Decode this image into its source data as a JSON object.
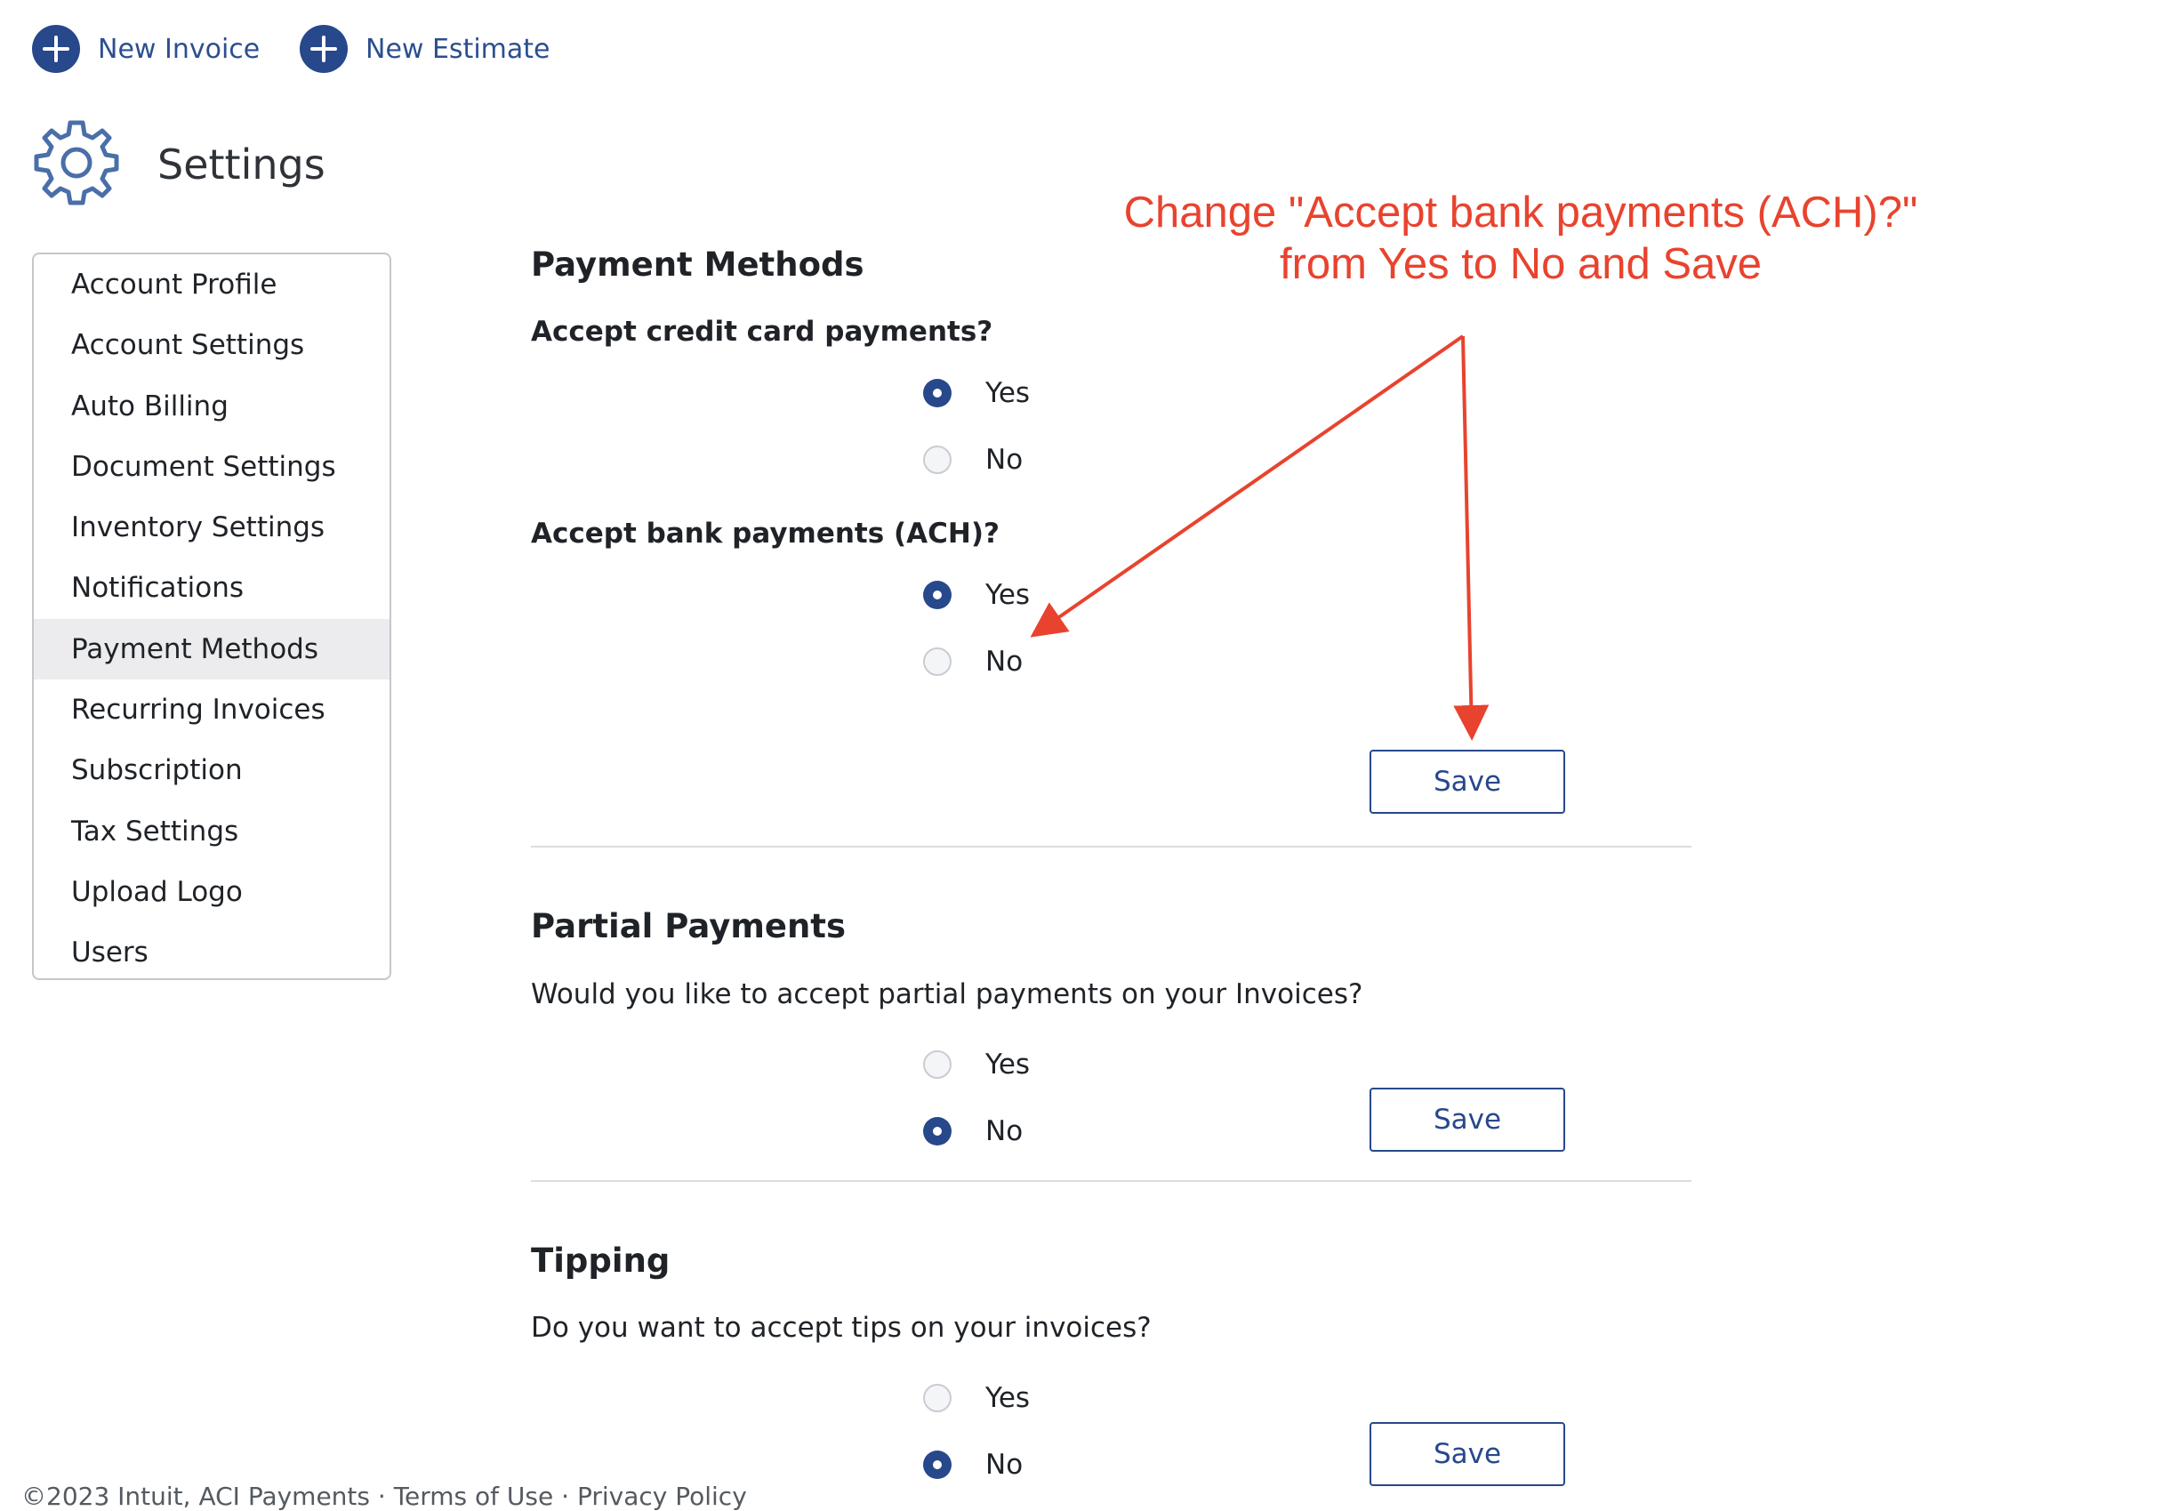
{
  "top_actions": {
    "new_invoice": "New Invoice",
    "new_estimate": "New Estimate"
  },
  "page": {
    "title": "Settings",
    "icon": "gear-icon"
  },
  "sidebar": {
    "items": [
      {
        "label": "Account Profile"
      },
      {
        "label": "Account Settings"
      },
      {
        "label": "Auto Billing"
      },
      {
        "label": "Document Settings"
      },
      {
        "label": "Inventory Settings"
      },
      {
        "label": "Notifications"
      },
      {
        "label": "Payment Methods",
        "active": true
      },
      {
        "label": "Recurring Invoices"
      },
      {
        "label": "Subscription"
      },
      {
        "label": "Tax Settings"
      },
      {
        "label": "Upload Logo"
      },
      {
        "label": "Users"
      }
    ]
  },
  "payment_methods": {
    "title": "Payment Methods",
    "credit_card": {
      "question": "Accept credit card payments?",
      "yes": "Yes",
      "no": "No",
      "selected": "Yes"
    },
    "ach": {
      "question": "Accept bank payments (ACH)?",
      "yes": "Yes",
      "no": "No",
      "selected": "Yes"
    },
    "save": "Save"
  },
  "partial_payments": {
    "title": "Partial Payments",
    "question": "Would you like to accept partial payments on your Invoices?",
    "yes": "Yes",
    "no": "No",
    "selected": "No",
    "save": "Save"
  },
  "tipping": {
    "title": "Tipping",
    "question": "Do you want to accept tips on your invoices?",
    "yes": "Yes",
    "no": "No",
    "selected": "No",
    "save": "Save"
  },
  "annotation": {
    "line1": "Change \"Accept bank payments (ACH)?\"",
    "line2": "from Yes to No and Save",
    "color": "#e8432e"
  },
  "footer": {
    "text": "©2023 Intuit, ACI Payments · Terms of Use · Privacy Policy"
  },
  "colors": {
    "brand": "#27488a",
    "link": "#2b4f8f",
    "active_bg": "#ececee"
  }
}
